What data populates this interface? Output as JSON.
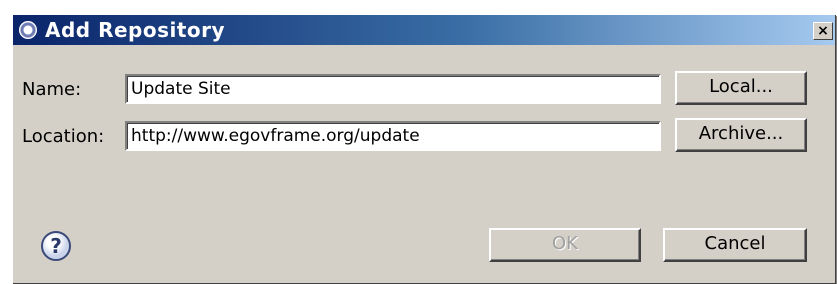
{
  "window": {
    "title": "Add Repository",
    "close_glyph": "×",
    "icon": "eclipse-icon"
  },
  "form": {
    "name_label": "Name:",
    "name_value": "Update Site",
    "location_label": "Location:",
    "location_value": "http://www.egovframe.org/update"
  },
  "buttons": {
    "local": "Local...",
    "archive": "Archive...",
    "ok": "OK",
    "cancel": "Cancel"
  },
  "help": {
    "glyph": "?",
    "icon": "help-icon"
  }
}
